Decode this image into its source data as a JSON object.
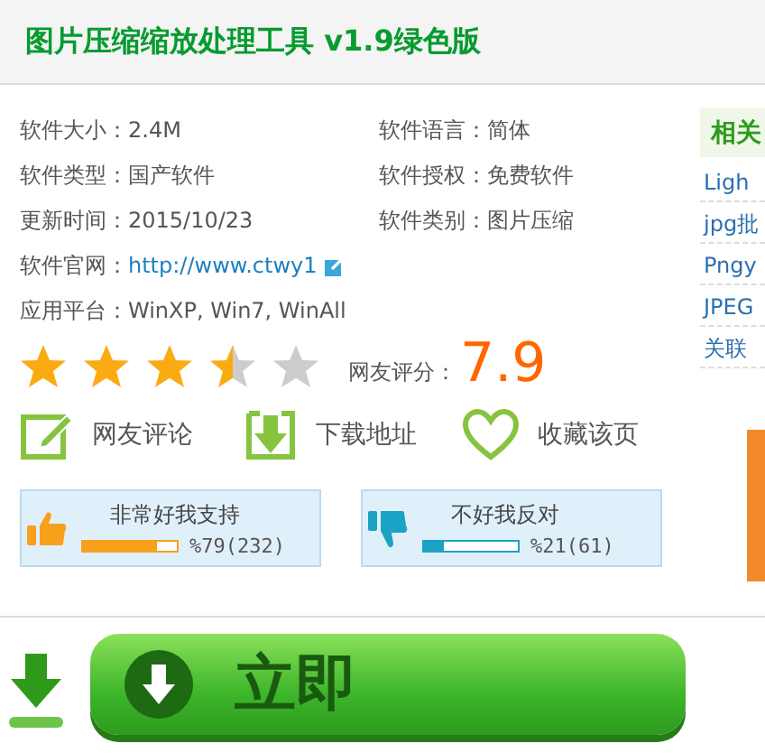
{
  "title": "图片压缩缩放处理工具 v1.9绿色版",
  "info": [
    {
      "label": "软件大小：",
      "value": "2.4M"
    },
    {
      "label": "软件语言：",
      "value": "简体"
    },
    {
      "label": "软件类型：",
      "value": "国产软件"
    },
    {
      "label": "软件授权：",
      "value": "免费软件"
    },
    {
      "label": "更新时间：",
      "value": "2015/10/23"
    },
    {
      "label": "软件类别：",
      "value": "图片压缩"
    }
  ],
  "website": {
    "label": "软件官网：",
    "value": "http://www.ctwy1"
  },
  "platform": {
    "label": "应用平台：",
    "value": "WinXP, Win7, WinAll"
  },
  "rating": {
    "stars": 3.5,
    "label": "网友评分：",
    "score": "7.9"
  },
  "actions": [
    {
      "kind": "comment",
      "label": "网友评论"
    },
    {
      "kind": "download",
      "label": "下载地址"
    },
    {
      "kind": "favorite",
      "label": "收藏该页"
    }
  ],
  "votes": [
    {
      "kind": "up",
      "label": "非常好我支持",
      "level": 0.79,
      "reading": "%79(232)"
    },
    {
      "kind": "down",
      "label": "不好我反对",
      "level": 0.21,
      "reading": "%21(61)"
    }
  ],
  "sidebar": {
    "heading": "相关",
    "links": [
      "Ligh",
      "jpg批",
      "Pngy",
      "JPEG",
      "关联"
    ]
  },
  "download_button": {
    "label": "立即"
  }
}
